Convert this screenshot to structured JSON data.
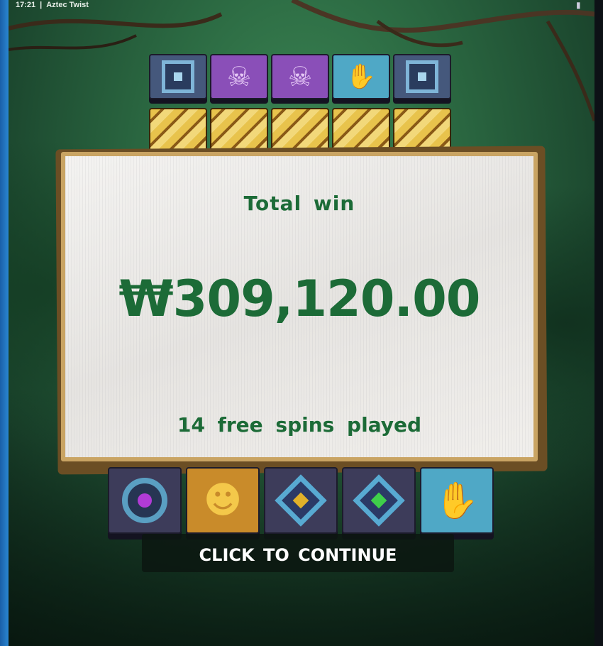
{
  "status_bar": {
    "time": "17:21",
    "separator": "|",
    "app_title": "Aztec Twist"
  },
  "popup": {
    "title": "Total win",
    "amount": "₩309,120.00",
    "subtitle": "14 free spins played"
  },
  "continue_label": "CLICK TO CONTINUE",
  "reels": {
    "top_row": [
      "square-glyph-icon",
      "skull-mask-icon",
      "skull-mask-icon",
      "spiral-hand-icon",
      "square-glyph-icon"
    ],
    "bottom_row": [
      "purple-orb-icon",
      "golden-mask-icon",
      "yellow-diamond-icon",
      "green-diamond-icon",
      "spiral-hand-icon"
    ]
  },
  "colors": {
    "popup_text": "#1c6b37",
    "jungle_green": "#2c6b43",
    "popup_frame": "#c9a463"
  }
}
